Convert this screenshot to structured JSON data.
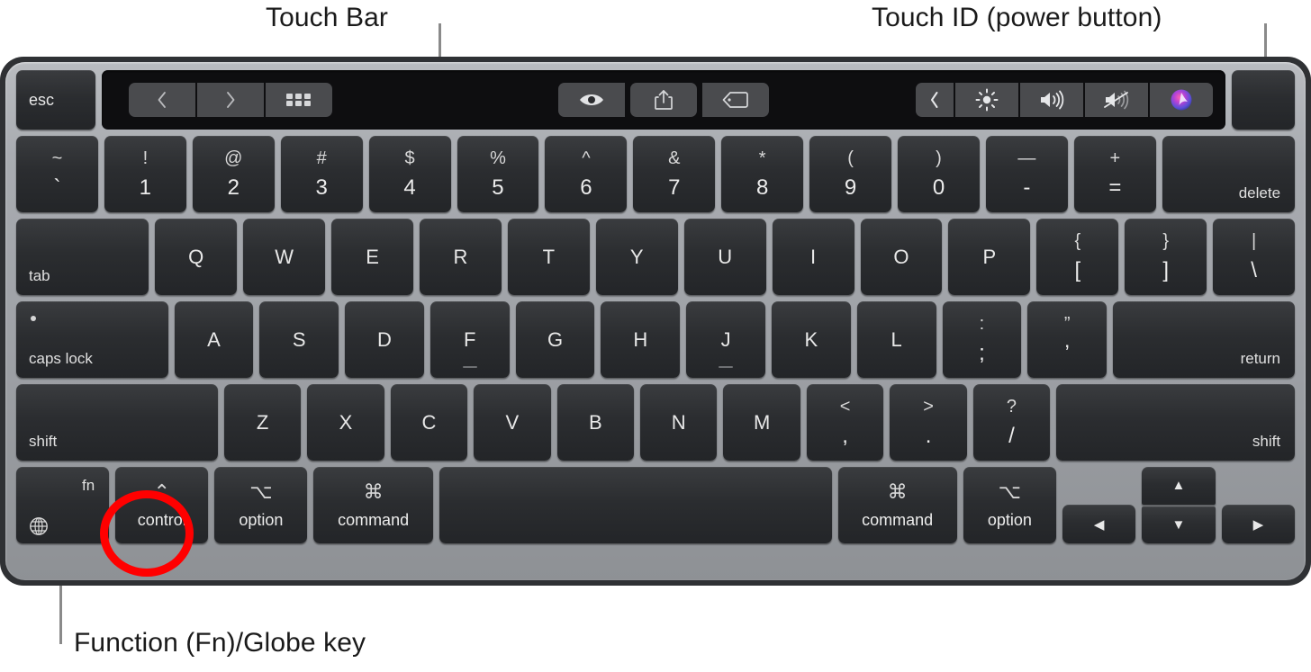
{
  "annotations": {
    "touch_bar": "Touch Bar",
    "touch_id": "Touch ID (power button)",
    "fn_globe": "Function (Fn)/Globe key"
  },
  "colors": {
    "highlight_ring": "#ff0000",
    "key_face": "#2b2d30",
    "bezel": "#a9acb1",
    "touchbar_bg": "#0e0e10",
    "leader_line": "#8a8a8a"
  },
  "touch_bar": {
    "esc_label": "esc",
    "left_group": [
      {
        "name": "back-icon",
        "label": "‹"
      },
      {
        "name": "forward-icon",
        "label": "›"
      },
      {
        "name": "grid-view-icon",
        "label": "grid"
      }
    ],
    "middle_group": [
      {
        "name": "quick-look-eye-icon",
        "label": "eye"
      },
      {
        "name": "share-icon",
        "label": "share"
      },
      {
        "name": "tag-icon",
        "label": "tag"
      }
    ],
    "control_strip": [
      {
        "name": "expand-control-strip-chevron-icon",
        "label": "‹"
      },
      {
        "name": "brightness-icon",
        "label": "brightness"
      },
      {
        "name": "volume-up-icon",
        "label": "volume"
      },
      {
        "name": "mute-icon",
        "label": "mute"
      },
      {
        "name": "siri-icon",
        "label": "siri"
      }
    ],
    "touch_id_label": ""
  },
  "rows": {
    "numbers": [
      {
        "name": "key-grave",
        "upper": "~",
        "lower": "`"
      },
      {
        "name": "key-1",
        "upper": "!",
        "lower": "1"
      },
      {
        "name": "key-2",
        "upper": "@",
        "lower": "2"
      },
      {
        "name": "key-3",
        "upper": "#",
        "lower": "3"
      },
      {
        "name": "key-4",
        "upper": "$",
        "lower": "4"
      },
      {
        "name": "key-5",
        "upper": "%",
        "lower": "5"
      },
      {
        "name": "key-6",
        "upper": "^",
        "lower": "6"
      },
      {
        "name": "key-7",
        "upper": "&",
        "lower": "7"
      },
      {
        "name": "key-8",
        "upper": "*",
        "lower": "8"
      },
      {
        "name": "key-9",
        "upper": "(",
        "lower": "9"
      },
      {
        "name": "key-0",
        "upper": ")",
        "lower": "0"
      },
      {
        "name": "key-minus",
        "upper": "—",
        "lower": "-"
      },
      {
        "name": "key-equal",
        "upper": "+",
        "lower": "="
      }
    ],
    "delete_label": "delete",
    "tab_label": "tab",
    "qwerty": [
      {
        "name": "key-q",
        "label": "Q"
      },
      {
        "name": "key-w",
        "label": "W"
      },
      {
        "name": "key-e",
        "label": "E"
      },
      {
        "name": "key-r",
        "label": "R"
      },
      {
        "name": "key-t",
        "label": "T"
      },
      {
        "name": "key-y",
        "label": "Y"
      },
      {
        "name": "key-u",
        "label": "U"
      },
      {
        "name": "key-i",
        "label": "I"
      },
      {
        "name": "key-o",
        "label": "O"
      },
      {
        "name": "key-p",
        "label": "P"
      }
    ],
    "qwerty_tail": [
      {
        "name": "key-bracket-left",
        "upper": "{",
        "lower": "["
      },
      {
        "name": "key-bracket-right",
        "upper": "}",
        "lower": "]"
      },
      {
        "name": "key-backslash",
        "upper": "|",
        "lower": "\\"
      }
    ],
    "caps_lock_label": "caps lock",
    "home": [
      {
        "name": "key-a",
        "label": "A",
        "bump": false
      },
      {
        "name": "key-s",
        "label": "S",
        "bump": false
      },
      {
        "name": "key-d",
        "label": "D",
        "bump": false
      },
      {
        "name": "key-f",
        "label": "F",
        "bump": true
      },
      {
        "name": "key-g",
        "label": "G",
        "bump": false
      },
      {
        "name": "key-h",
        "label": "H",
        "bump": false
      },
      {
        "name": "key-j",
        "label": "J",
        "bump": true
      },
      {
        "name": "key-k",
        "label": "K",
        "bump": false
      },
      {
        "name": "key-l",
        "label": "L",
        "bump": false
      }
    ],
    "home_tail": [
      {
        "name": "key-semicolon",
        "upper": ":",
        "lower": ";"
      },
      {
        "name": "key-quote",
        "upper": "”",
        "lower": "’"
      }
    ],
    "return_label": "return",
    "shift_left_label": "shift",
    "shift_right_label": "shift",
    "zxcv": [
      {
        "name": "key-z",
        "label": "Z"
      },
      {
        "name": "key-x",
        "label": "X"
      },
      {
        "name": "key-c",
        "label": "C"
      },
      {
        "name": "key-v",
        "label": "V"
      },
      {
        "name": "key-b",
        "label": "B"
      },
      {
        "name": "key-n",
        "label": "N"
      },
      {
        "name": "key-m",
        "label": "M"
      }
    ],
    "zxcv_tail": [
      {
        "name": "key-comma",
        "upper": "<",
        "lower": ","
      },
      {
        "name": "key-period",
        "upper": ">",
        "lower": "."
      },
      {
        "name": "key-slash",
        "upper": "?",
        "lower": "/"
      }
    ],
    "bottom": {
      "fn_label": "fn",
      "control_symbol": "⌃",
      "control_label": "control",
      "option_symbol": "⌥",
      "option_label": "option",
      "command_symbol": "⌘",
      "command_label": "command",
      "space_label": "",
      "command_right_symbol": "⌘",
      "command_right_label": "command",
      "option_right_symbol": "⌥",
      "option_right_label": "option",
      "arrow_left": "◀",
      "arrow_up": "▲",
      "arrow_down": "▼",
      "arrow_right": "▶"
    }
  }
}
